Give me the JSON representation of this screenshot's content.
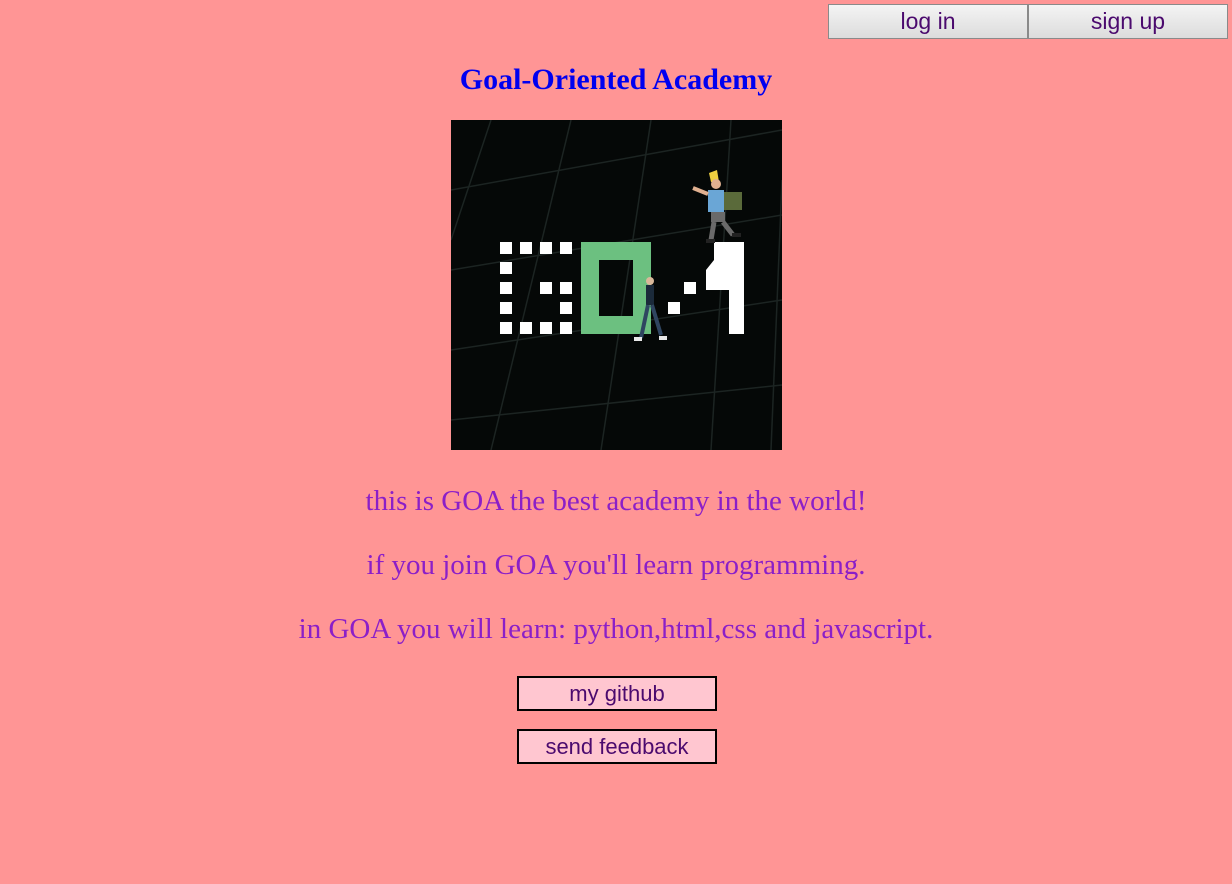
{
  "header": {
    "login_label": "log in",
    "signup_label": "sign up"
  },
  "page": {
    "title": "Goal-Oriented Academy"
  },
  "logo": {
    "name": "goa-logo-icon",
    "lettering": "GOA"
  },
  "main": {
    "lines": [
      "this is GOA the best academy in the world!",
      "if you join GOA you'll learn programming.",
      "in GOA you will learn: python,html,css and javascript."
    ],
    "github_label": "my github",
    "feedback_label": "send feedback"
  },
  "colors": {
    "background": "#ff9595",
    "title": "#0000f0",
    "body_text": "#8b1fc8",
    "button_text": "#4b0a6e",
    "link_button_bg": "#ffc6d0",
    "logo_bg": "#050807",
    "logo_green": "#6cc080"
  }
}
